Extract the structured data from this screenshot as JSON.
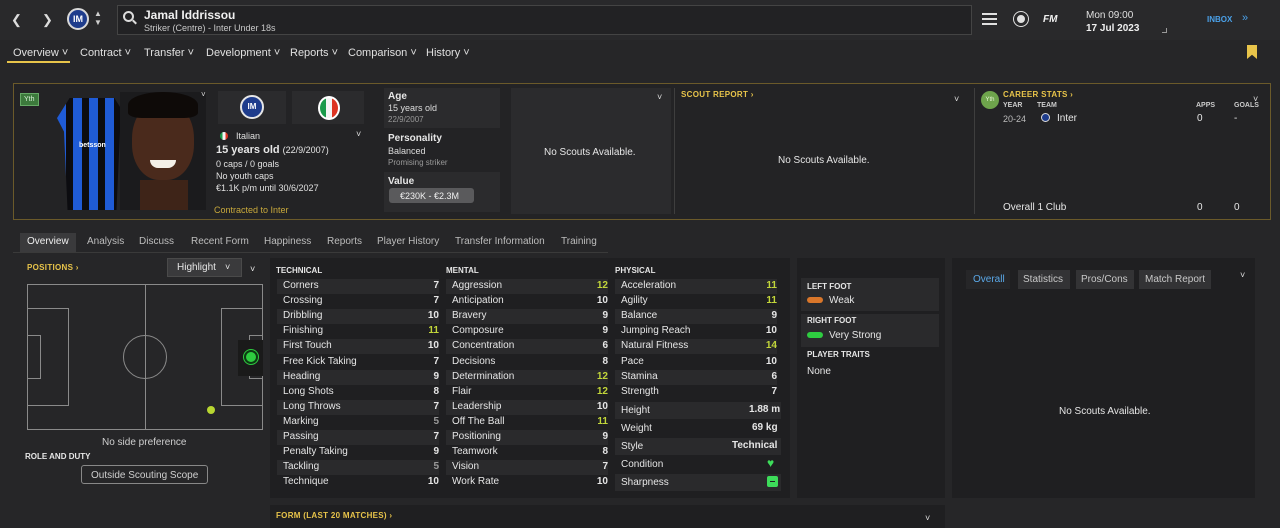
{
  "header": {
    "player_name": "Jamal Iddrissou",
    "player_subtitle": "Striker (Centre) - Inter Under 18s",
    "date_line1": "Mon 09:00",
    "date_line2": "17 Jul 2023",
    "inbox_label": "INBOX",
    "fm_label": "FM"
  },
  "menu": [
    "Overview",
    "Contract",
    "Transfer",
    "Development",
    "Reports",
    "Comparison",
    "History"
  ],
  "profile": {
    "badge": "Yth",
    "nationality": "Italian",
    "age_line": "15 years old",
    "dob_paren": "(22/9/2007)",
    "caps": "0 caps / 0 goals",
    "youth_caps": "No youth caps",
    "wage": "€1.1K p/m until 30/6/2027",
    "contract": "Contracted to Inter"
  },
  "info": {
    "age_label": "Age",
    "age_value": "15 years old",
    "age_dob": "22/9/2007",
    "personality_label": "Personality",
    "personality_value": "Balanced",
    "personality_note": "Promising striker",
    "value_label": "Value",
    "value_range": "€230K - €2.3M"
  },
  "scouts_box": {
    "text": "No Scouts Available."
  },
  "scout_report": {
    "title": "SCOUT REPORT",
    "text": "No Scouts Available."
  },
  "career": {
    "badge": "Yth",
    "title": "CAREER STATS",
    "col_year": "YEAR",
    "col_team": "TEAM",
    "col_apps": "APPS",
    "col_goals": "GOALS",
    "row_year": "20-24",
    "row_team": "Inter",
    "row_apps": "0",
    "row_goals": "-",
    "total_label": "Overall 1 Club",
    "total_apps": "0",
    "total_goals": "0"
  },
  "subtabs": [
    "Overview",
    "Analysis",
    "Discuss",
    "Recent Form",
    "Happiness",
    "Reports",
    "Player History",
    "Transfer Information",
    "Training"
  ],
  "positions": {
    "title": "POSITIONS",
    "highlight_label": "Highlight",
    "side_pref": "No side preference",
    "role_title": "ROLE AND DUTY",
    "scope_button": "Outside Scouting Scope"
  },
  "technical": {
    "title": "TECHNICAL",
    "attrs": [
      {
        "n": "Corners",
        "v": "7"
      },
      {
        "n": "Crossing",
        "v": "7"
      },
      {
        "n": "Dribbling",
        "v": "10"
      },
      {
        "n": "Finishing",
        "v": "11"
      },
      {
        "n": "First Touch",
        "v": "10"
      },
      {
        "n": "Free Kick Taking",
        "v": "7"
      },
      {
        "n": "Heading",
        "v": "9"
      },
      {
        "n": "Long Shots",
        "v": "8"
      },
      {
        "n": "Long Throws",
        "v": "7"
      },
      {
        "n": "Marking",
        "v": "5"
      },
      {
        "n": "Passing",
        "v": "7"
      },
      {
        "n": "Penalty Taking",
        "v": "9"
      },
      {
        "n": "Tackling",
        "v": "5"
      },
      {
        "n": "Technique",
        "v": "10"
      }
    ]
  },
  "mental": {
    "title": "MENTAL",
    "attrs": [
      {
        "n": "Aggression",
        "v": "12"
      },
      {
        "n": "Anticipation",
        "v": "10"
      },
      {
        "n": "Bravery",
        "v": "9"
      },
      {
        "n": "Composure",
        "v": "9"
      },
      {
        "n": "Concentration",
        "v": "6"
      },
      {
        "n": "Decisions",
        "v": "8"
      },
      {
        "n": "Determination",
        "v": "12"
      },
      {
        "n": "Flair",
        "v": "12"
      },
      {
        "n": "Leadership",
        "v": "10"
      },
      {
        "n": "Off The Ball",
        "v": "11"
      },
      {
        "n": "Positioning",
        "v": "9"
      },
      {
        "n": "Teamwork",
        "v": "8"
      },
      {
        "n": "Vision",
        "v": "7"
      },
      {
        "n": "Work Rate",
        "v": "10"
      }
    ]
  },
  "physical": {
    "title": "PHYSICAL",
    "attrs": [
      {
        "n": "Acceleration",
        "v": "11"
      },
      {
        "n": "Agility",
        "v": "11"
      },
      {
        "n": "Balance",
        "v": "9"
      },
      {
        "n": "Jumping Reach",
        "v": "10"
      },
      {
        "n": "Natural Fitness",
        "v": "14"
      },
      {
        "n": "Pace",
        "v": "10"
      },
      {
        "n": "Stamina",
        "v": "6"
      },
      {
        "n": "Strength",
        "v": "7"
      }
    ],
    "height_label": "Height",
    "height_value": "1.88 m",
    "weight_label": "Weight",
    "weight_value": "69 kg",
    "style_label": "Style",
    "style_value": "Technical",
    "condition_label": "Condition",
    "sharpness_label": "Sharpness"
  },
  "feet": {
    "left_title": "LEFT FOOT",
    "left_value": "Weak",
    "right_title": "RIGHT FOOT",
    "right_value": "Very Strong",
    "traits_title": "PLAYER TRAITS",
    "traits_value": "None"
  },
  "right_panel": {
    "tabs": [
      "Overall",
      "Statistics",
      "Pros/Cons",
      "Match Report"
    ],
    "text": "No Scouts Available."
  },
  "form": {
    "title": "FORM (LAST 20 MATCHES)"
  },
  "colors": {
    "accent_gold": "#e8c44a",
    "high_attr": "#c2d63a",
    "green_dot": "#2ecc40",
    "condition_green": "#3ddc5a"
  }
}
